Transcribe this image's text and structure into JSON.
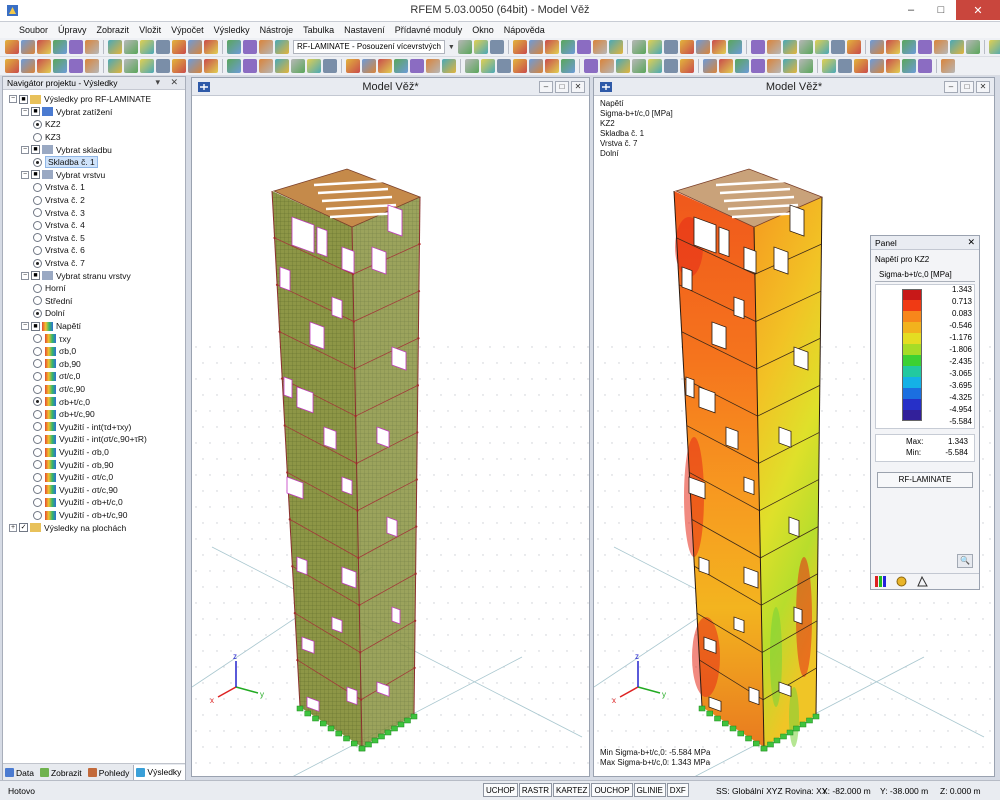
{
  "app": {
    "title": "RFEM 5.03.0050 (64bit) - Model Věž",
    "window_buttons": [
      "–",
      "□",
      "✕"
    ]
  },
  "menu": [
    "Soubor",
    "Úpravy",
    "Zobrazit",
    "Vložit",
    "Výpočet",
    "Výsledky",
    "Nástroje",
    "Tabulka",
    "Nastavení",
    "Přídavné moduly",
    "Okno",
    "Nápověda"
  ],
  "toolbar": {
    "combo": "RF-LAMINATE - Posouzení vícevrstvých"
  },
  "navigator": {
    "title": "Navigátor projektu - Výsledky",
    "header_buttons": "▾ ✕",
    "tree": [
      {
        "level": 0,
        "exp": "−",
        "cb": "■",
        "label": "Výsledky pro RF-LAMINATE",
        "icon": "folder"
      },
      {
        "level": 1,
        "exp": "−",
        "cb": "■",
        "label": "Vybrat zatížení",
        "icon": "load"
      },
      {
        "level": 2,
        "radio": true,
        "sel": true,
        "label": "KZ2"
      },
      {
        "level": 2,
        "radio": true,
        "sel": false,
        "label": "KZ3"
      },
      {
        "level": 1,
        "exp": "−",
        "cb": "■",
        "label": "Vybrat skladbu",
        "icon": "layer"
      },
      {
        "level": 2,
        "radio": true,
        "sel": true,
        "label": "Skladba č. 1",
        "selected": true
      },
      {
        "level": 1,
        "exp": "−",
        "cb": "■",
        "label": "Vybrat vrstvu",
        "icon": "layer"
      },
      {
        "level": 2,
        "radio": true,
        "sel": false,
        "label": "Vrstva č. 1"
      },
      {
        "level": 2,
        "radio": true,
        "sel": false,
        "label": "Vrstva č. 2"
      },
      {
        "level": 2,
        "radio": true,
        "sel": false,
        "label": "Vrstva č. 3"
      },
      {
        "level": 2,
        "radio": true,
        "sel": false,
        "label": "Vrstva č. 4"
      },
      {
        "level": 2,
        "radio": true,
        "sel": false,
        "label": "Vrstva č. 5"
      },
      {
        "level": 2,
        "radio": true,
        "sel": false,
        "label": "Vrstva č. 6"
      },
      {
        "level": 2,
        "radio": true,
        "sel": true,
        "label": "Vrstva č. 7"
      },
      {
        "level": 1,
        "exp": "−",
        "cb": "■",
        "label": "Vybrat stranu vrstvy",
        "icon": "layer"
      },
      {
        "level": 2,
        "radio": true,
        "sel": false,
        "label": "Horní"
      },
      {
        "level": 2,
        "radio": true,
        "sel": false,
        "label": "Střední"
      },
      {
        "level": 2,
        "radio": true,
        "sel": true,
        "label": "Dolní"
      },
      {
        "level": 1,
        "exp": "−",
        "cb": "■",
        "label": "Napětí",
        "icon": "stress"
      },
      {
        "level": 2,
        "radio": true,
        "sel": false,
        "label": "τxy",
        "icon": "stress"
      },
      {
        "level": 2,
        "radio": true,
        "sel": false,
        "label": "σb,0",
        "icon": "stress"
      },
      {
        "level": 2,
        "radio": true,
        "sel": false,
        "label": "σb,90",
        "icon": "stress"
      },
      {
        "level": 2,
        "radio": true,
        "sel": false,
        "label": "σt/c,0",
        "icon": "stress"
      },
      {
        "level": 2,
        "radio": true,
        "sel": false,
        "label": "σt/c,90",
        "icon": "stress"
      },
      {
        "level": 2,
        "radio": true,
        "sel": true,
        "label": "σb+t/c,0",
        "icon": "stress"
      },
      {
        "level": 2,
        "radio": true,
        "sel": false,
        "label": "σb+t/c,90",
        "icon": "stress"
      },
      {
        "level": 2,
        "radio": true,
        "sel": false,
        "label": "Využití - int(τd+τxy)",
        "icon": "stress"
      },
      {
        "level": 2,
        "radio": true,
        "sel": false,
        "label": "Využití - int(σt/c,90+τR)",
        "icon": "stress"
      },
      {
        "level": 2,
        "radio": true,
        "sel": false,
        "label": "Využití - σb,0",
        "icon": "stress"
      },
      {
        "level": 2,
        "radio": true,
        "sel": false,
        "label": "Využití - σb,90",
        "icon": "stress"
      },
      {
        "level": 2,
        "radio": true,
        "sel": false,
        "label": "Využití - σt/c,0",
        "icon": "stress"
      },
      {
        "level": 2,
        "radio": true,
        "sel": false,
        "label": "Využití - σt/c,90",
        "icon": "stress"
      },
      {
        "level": 2,
        "radio": true,
        "sel": false,
        "label": "Využití - σb+t/c,0",
        "icon": "stress"
      },
      {
        "level": 2,
        "radio": true,
        "sel": false,
        "label": "Využití - σb+t/c,90",
        "icon": "stress"
      },
      {
        "level": 0,
        "exp": "+",
        "cb": "✓",
        "label": "Výsledky na plochách",
        "icon": "folder"
      }
    ],
    "tabs": [
      "Data",
      "Zobrazit",
      "Pohledy",
      "Výsledky"
    ],
    "active_tab": "Výsledky"
  },
  "windows": {
    "left_title": "Model Věž*",
    "right_title": "Model Věž*",
    "buttons": [
      "–",
      "□",
      "✕"
    ]
  },
  "result_info": {
    "top": [
      "Napětí",
      "Sigma-b+t/c,0 [MPa]",
      "KZ2",
      "Skladba č. 1",
      "Vrstva č. 7",
      "Dolní"
    ],
    "bottom": [
      "Min Sigma-b+t/c,0: -5.584 MPa",
      "Max Sigma-b+t/c,0: 1.343 MPa"
    ]
  },
  "panel": {
    "title": "Panel",
    "close": "✕",
    "heading": "Napětí pro KZ2",
    "unit_label": "Sigma-b+t/c,0 [MPa]",
    "legend_values": [
      "1.343",
      "0.713",
      "0.083",
      "-0.546",
      "-1.176",
      "-1.806",
      "-2.435",
      "-3.065",
      "-3.695",
      "-4.325",
      "-4.954",
      "-5.584"
    ],
    "legend_colors": [
      "#c81818",
      "#f03a14",
      "#f7861b",
      "#f2b21d",
      "#e4dd22",
      "#a6dc27",
      "#3cd133",
      "#22c9a0",
      "#14b1e6",
      "#1b6fe0",
      "#2630c8",
      "#32209a"
    ],
    "max_label": "Max:",
    "max_value": "1.343",
    "min_label": "Min:",
    "min_value": "-5.584",
    "button": "RF-LAMINATE",
    "zoom_icon": "🔍"
  },
  "status": {
    "ready": "Hotovo",
    "buttons": [
      "UCHOP",
      "RASTR",
      "KARTEZ",
      "OUCHOP",
      "GLINIE",
      "DXF"
    ],
    "system": "SS: Globální XYZ Rovina: XY",
    "x": "X: -82.000 m",
    "y": "Y: -38.000 m",
    "z": "Z: 0.000 m"
  },
  "axes": {
    "x": "x",
    "y": "y",
    "z": "z"
  }
}
